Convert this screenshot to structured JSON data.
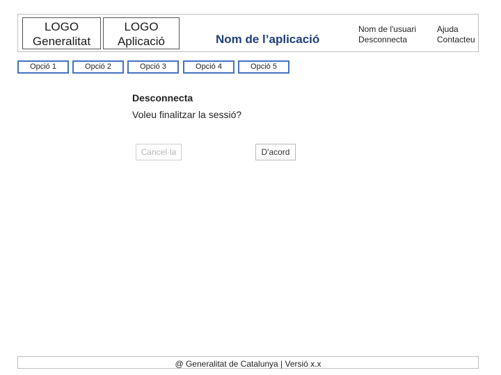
{
  "header": {
    "logo_generalitat": {
      "line1": "LOGO",
      "line2": "Generalitat"
    },
    "logo_app": {
      "line1": "LOGO",
      "line2": "Aplicació"
    },
    "app_name": "Nom de l’aplicació",
    "user": {
      "name": "Nom de l'usuari",
      "logout": "Desconnecta"
    },
    "help": {
      "help": "Ajuda",
      "contact": "Contacteu"
    }
  },
  "nav": {
    "items": [
      {
        "label": "Opció 1"
      },
      {
        "label": "Opció 2"
      },
      {
        "label": "Opció 3"
      },
      {
        "label": "Opció 4"
      },
      {
        "label": "Opció 5"
      }
    ]
  },
  "dialog": {
    "title": "Desconnecta",
    "message": "Voleu finalitzar la sessió?",
    "cancel_label": "Cancel·la",
    "ok_label": "D'acord"
  },
  "footer": {
    "text": "@ Generalitat de Catalunya | Versió x.x"
  },
  "colors": {
    "nav_border": "#4472c4",
    "app_name": "#1f3f7a"
  }
}
